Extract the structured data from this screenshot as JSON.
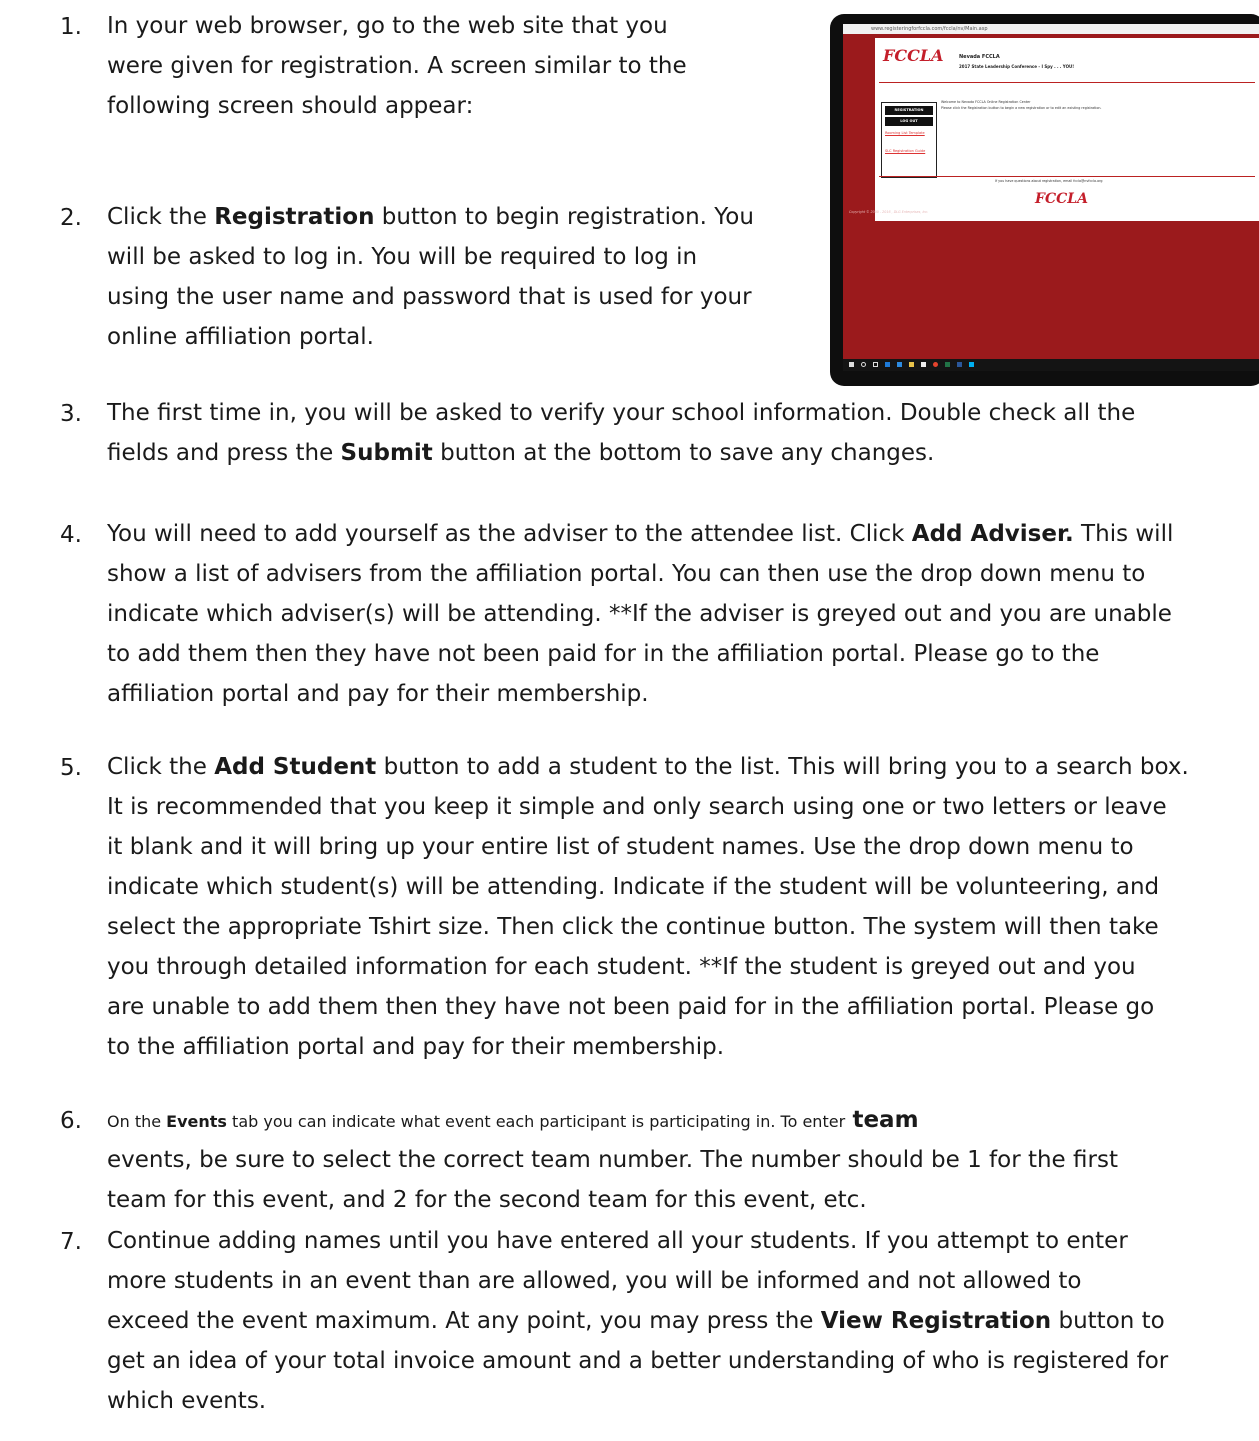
{
  "steps": [
    {
      "num": "1.",
      "lines": [
        "In your web browser, go to the web site that you",
        "were given for registration.   A screen similar to the",
        "following screen should appear:"
      ]
    },
    {
      "num": "2.",
      "lines": [
        "Click the <b>Registration</b> button to begin registration. You",
        "will be asked to log in.  You will be required to log in",
        "using the user name and password that is used for your",
        "online affiliation portal."
      ]
    },
    {
      "num": "3.",
      "lines": [
        "The first time in, you will be asked to verify your school information. Double check all the",
        "fields and press the <b>Submit</b> button at the bottom to save any changes."
      ]
    },
    {
      "num": "4.",
      "lines": [
        "You will need to add yourself as the adviser to the attendee list. Click <b>Add Adviser.</b> This will",
        "show a list of advisers from the affiliation portal. You can then use the drop down menu to",
        "indicate which adviser(s) will be attending. **If the adviser is greyed out and you are unable",
        "to add them then they have not been paid for in the affiliation portal. Please go to the",
        "affiliation portal and pay for their membership."
      ]
    },
    {
      "num": "5.",
      "lines": [
        "Click the <b>Add Student</b> button to add a student to the list. This will bring you to a search box.",
        "It is recommended that you keep it simple and only search using one or two letters or leave",
        "it blank and it will bring up your entire list of student names. Use the drop down menu to",
        "indicate which student(s) will be attending. Indicate if the student will be volunteering, and",
        "select the appropriate Tshirt size. Then click the continue button. The system will then take",
        "you through detailed information for each student.  **If the student is greyed out and you",
        "are unable to add them then they have not been paid for in the affiliation portal. Please go",
        "to the affiliation portal and pay for their membership."
      ]
    },
    {
      "num": "6.",
      "lines": [
        "<span class=\"small\">On the <b>Events</b> tab you can indicate what event each participant is participating in. To enter</span> <b>team</b>",
        "events, be sure to select the correct team number. The number should be 1 for the first",
        "team for this event, and 2 for the second team for this event, etc."
      ]
    },
    {
      "num": "7.",
      "lines": [
        "Continue adding names until you have entered all your students. If you attempt to enter",
        "more students in an event than are allowed, you will be informed and not allowed to",
        "exceed the event maximum. At any point, you may press the <b>View Registration</b> button to",
        "get an idea of your total invoice amount and a better understanding of who is registered for",
        "which events."
      ]
    }
  ],
  "screenshot": {
    "url": "www.registeringforfccla.com/fccla/nv/Main.asp",
    "org": "Nevada FCCLA",
    "conference": "2017 State Leadership Conference - I Spy . . . YOU!",
    "logo": "FCCLA",
    "buttons": [
      "REGISTRATION",
      "LOG OUT"
    ],
    "links": [
      "Rooming List Template",
      "SLC Registration Guide"
    ],
    "welcome": "Welcome to Nevada FCCLA Online Registration Center",
    "instruction": "Please click the Registration button to begin a new registration or to edit an existing registration.",
    "questions": "If you have questions about registration, email fccla@nvfccla.org",
    "copyright": "Copyright © 2000 - 2016 , DLG Enterprises, Inc.",
    "colors": {
      "background": "#9b1a1c",
      "accent": "#c41e2a"
    }
  }
}
